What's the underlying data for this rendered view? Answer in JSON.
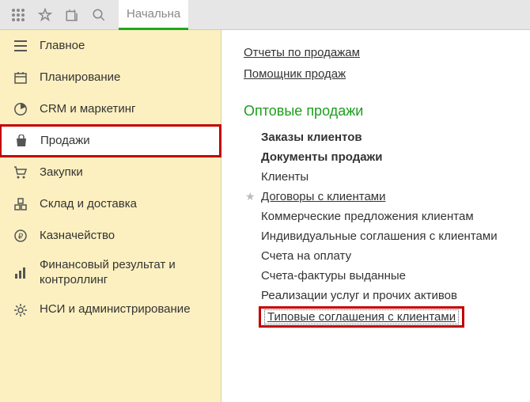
{
  "topbar": {
    "tab_label": "Начальна"
  },
  "sidebar": {
    "items": [
      {
        "label": "Главное",
        "icon": "menu"
      },
      {
        "label": "Планирование",
        "icon": "calendar"
      },
      {
        "label": "CRM и маркетинг",
        "icon": "pie"
      },
      {
        "label": "Продажи",
        "icon": "bag",
        "active": true,
        "highlight": true
      },
      {
        "label": "Закупки",
        "icon": "cart"
      },
      {
        "label": "Склад и доставка",
        "icon": "box"
      },
      {
        "label": "Казначейство",
        "icon": "ruble"
      },
      {
        "label": "Финансовый результат и контроллинг",
        "icon": "bars"
      },
      {
        "label": "НСИ и администрирование",
        "icon": "gear"
      }
    ]
  },
  "content": {
    "top_links": [
      "Отчеты по продажам",
      "Помощник продаж"
    ],
    "section_title": "Оптовые продажи",
    "sub_links": [
      {
        "label": "Заказы клиентов",
        "style": "bold"
      },
      {
        "label": "Документы продажи",
        "style": "bold"
      },
      {
        "label": "Клиенты",
        "style": "plain"
      },
      {
        "label": "Договоры с клиентами",
        "style": "underline",
        "star": true
      },
      {
        "label": "Коммерческие предложения клиентам",
        "style": "plain"
      },
      {
        "label": "Индивидуальные соглашения с клиентами",
        "style": "plain"
      },
      {
        "label": "Счета на оплату",
        "style": "plain"
      },
      {
        "label": "Счета-фактуры выданные",
        "style": "plain"
      },
      {
        "label": "Реализации услуг и прочих активов",
        "style": "plain"
      },
      {
        "label": "Типовые соглашения с клиентами",
        "style": "underline",
        "highlight": true,
        "dotted": true
      }
    ]
  }
}
